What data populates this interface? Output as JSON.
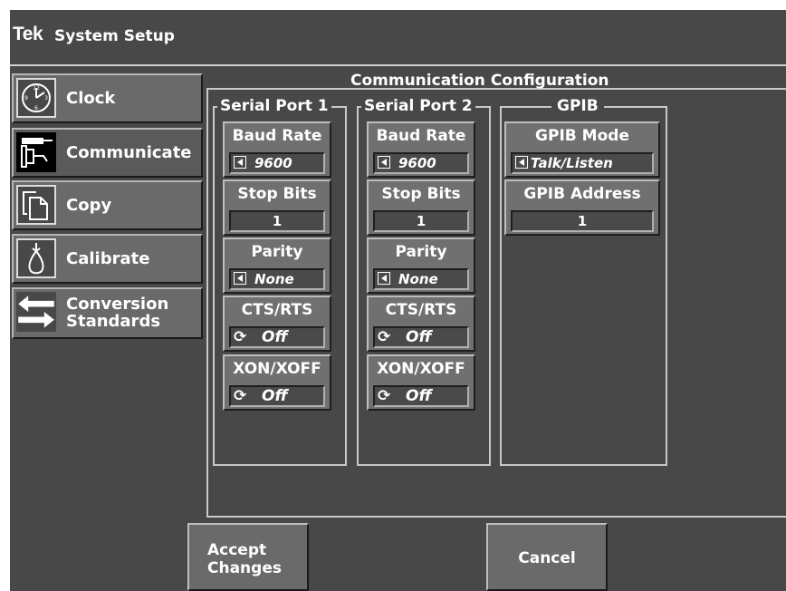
{
  "title": {
    "brand": "Tek",
    "name": "System Setup"
  },
  "sidebar": {
    "items": [
      {
        "label": "Clock",
        "icon": "clock-icon"
      },
      {
        "label": "Communicate",
        "icon": "connector-icon",
        "active": true
      },
      {
        "label": "Copy",
        "icon": "copy-icon"
      },
      {
        "label": "Calibrate",
        "icon": "calibrate-probe-icon"
      },
      {
        "label": "Conversion",
        "label2": "Standards",
        "icon": "conversion-arrows-icon"
      }
    ]
  },
  "panel": {
    "title": "Communication Configuration",
    "serial1": {
      "title": "Serial Port 1",
      "baud_label": "Baud Rate",
      "baud_value": "9600",
      "stop_label": "Stop Bits",
      "stop_value": "1",
      "parity_label": "Parity",
      "parity_value": "None",
      "cts_label": "CTS/RTS",
      "cts_value": "Off",
      "xon_label": "XON/XOFF",
      "xon_value": "Off"
    },
    "serial2": {
      "title": "Serial Port 2",
      "baud_label": "Baud Rate",
      "baud_value": "9600",
      "stop_label": "Stop Bits",
      "stop_value": "1",
      "parity_label": "Parity",
      "parity_value": "None",
      "cts_label": "CTS/RTS",
      "cts_value": "Off",
      "xon_label": "XON/XOFF",
      "xon_value": "Off"
    },
    "gpib": {
      "title": "GPIB",
      "mode_label": "GPIB Mode",
      "mode_value": "Talk/Listen",
      "address_label": "GPIB Address",
      "address_value": "1"
    }
  },
  "buttons": {
    "accept_line1": "Accept",
    "accept_line2": "Changes",
    "cancel": "Cancel"
  },
  "colors": {
    "background": "#484848",
    "button": "#6a6a6a",
    "text": "#ffffff"
  }
}
